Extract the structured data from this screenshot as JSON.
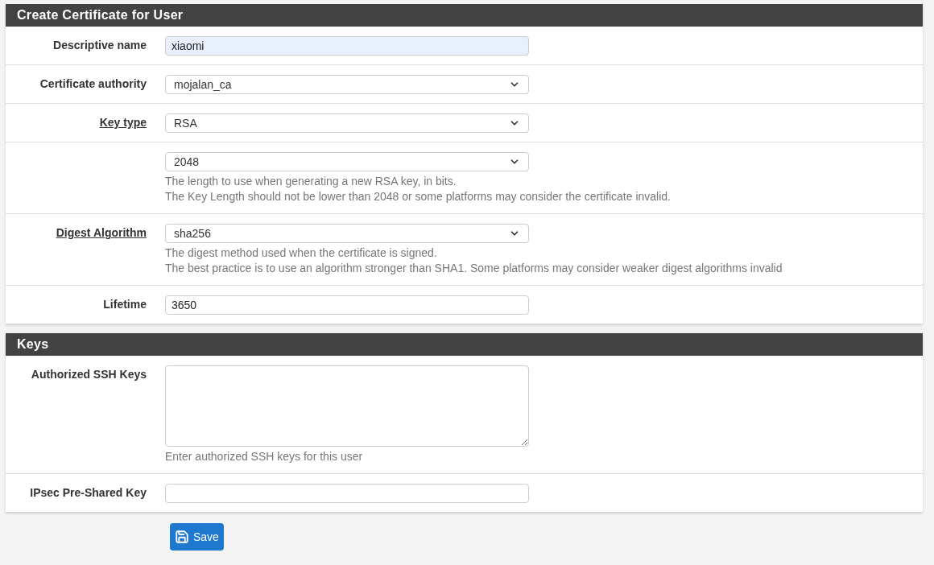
{
  "panels": [
    {
      "title": "Create Certificate for User",
      "rows": [
        {
          "label": "Descriptive name",
          "linked": false,
          "kind": "text",
          "value": "xiaomi",
          "highlighted": true
        },
        {
          "label": "Certificate authority",
          "linked": false,
          "kind": "select",
          "value": "mojalan_ca"
        },
        {
          "label": "Key type",
          "linked": true,
          "kind": "select",
          "value": "RSA"
        },
        {
          "kind": "select",
          "value": "2048",
          "help": [
            "The length to use when generating a new RSA key, in bits.",
            "The Key Length should not be lower than 2048 or some platforms may consider the certificate invalid."
          ]
        },
        {
          "label": "Digest Algorithm",
          "linked": true,
          "kind": "select",
          "value": "sha256",
          "help": [
            "The digest method used when the certificate is signed.",
            "The best practice is to use an algorithm stronger than SHA1. Some platforms may consider weaker digest algorithms invalid"
          ]
        },
        {
          "label": "Lifetime",
          "linked": false,
          "kind": "text",
          "value": "3650",
          "highlighted": false
        }
      ]
    },
    {
      "title": "Keys",
      "rows": [
        {
          "label": "Authorized SSH Keys",
          "linked": false,
          "kind": "textarea",
          "help": [
            "Enter authorized SSH keys for this user"
          ]
        },
        {
          "label": "IPsec Pre-Shared Key",
          "linked": false,
          "kind": "text",
          "highlighted": false
        }
      ]
    }
  ],
  "save_button": "Save"
}
